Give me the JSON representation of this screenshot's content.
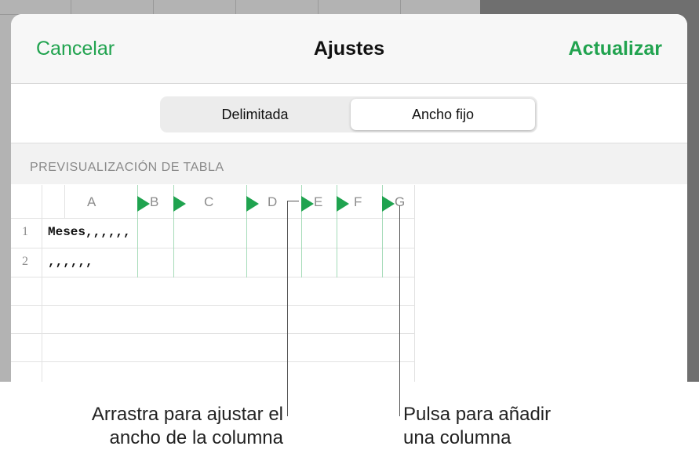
{
  "navbar": {
    "cancel_label": "Cancelar",
    "title": "Ajustes",
    "update_label": "Actualizar"
  },
  "segmented": {
    "options": [
      "Delimitada",
      "Ancho fijo"
    ],
    "selected": "Ancho fijo"
  },
  "preview": {
    "section_label": "PREVISUALIZACIÓN DE TABLA",
    "columns": [
      "A",
      "B",
      "C",
      "D",
      "E",
      "F",
      "G"
    ],
    "rows": [
      {
        "num": "1",
        "value": "Meses,,,,,,"
      },
      {
        "num": "2",
        "value": ",,,,,,"
      }
    ]
  },
  "callouts": {
    "drag_line1": "Arrastra para ajustar el",
    "drag_line2": "ancho de la columna",
    "tap_line1": "Pulsa para añadir",
    "tap_line2": "una columna"
  },
  "colors": {
    "accent": "#21a34f",
    "marker": "#1fa34f"
  },
  "icons": [
    "column-split-marker-icon"
  ]
}
